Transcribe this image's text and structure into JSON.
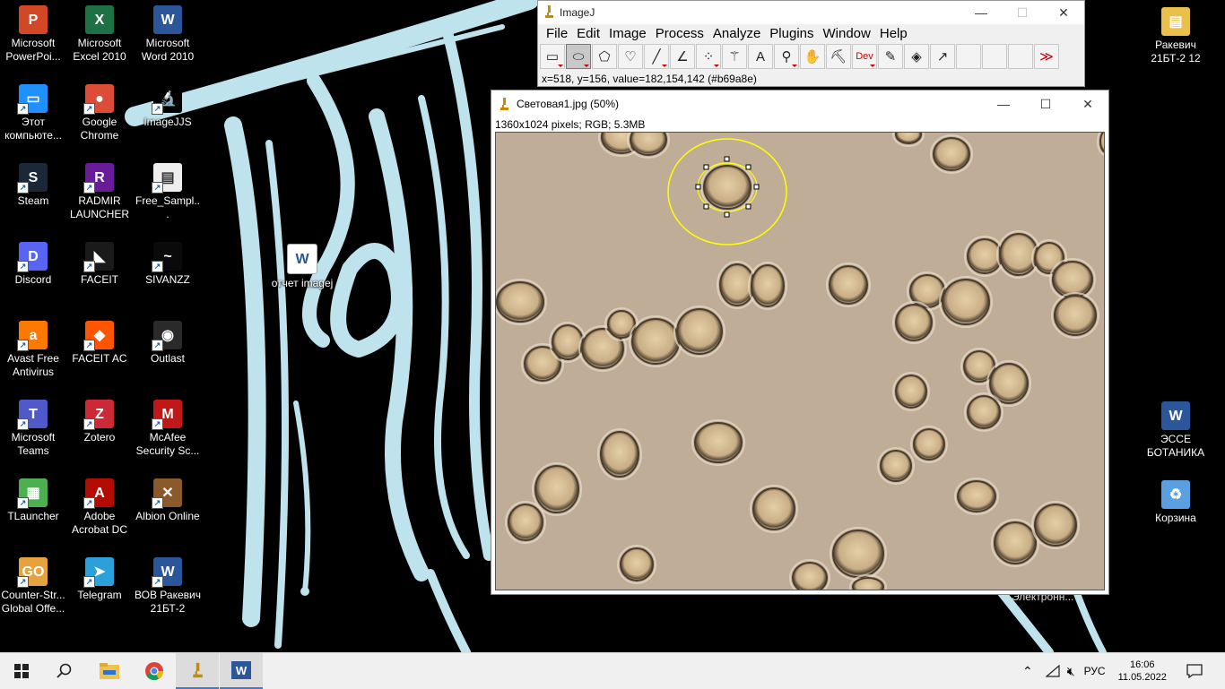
{
  "desktop": {
    "icons": [
      {
        "label": "Microsoft PowerPoi...",
        "icon": "powerpoint-icon",
        "color": "#d24726",
        "glyph": "P"
      },
      {
        "label": "Microsoft Excel 2010",
        "icon": "excel-icon",
        "color": "#1e7145",
        "glyph": "X"
      },
      {
        "label": "Microsoft Word 2010",
        "icon": "word-icon",
        "color": "#2b579a",
        "glyph": "W"
      },
      {
        "label": "Этот компьюте...",
        "icon": "computer-icon",
        "color": "#1e90ff",
        "glyph": "▭"
      },
      {
        "label": "Google Chrome",
        "icon": "chrome-icon",
        "color": "#dd4b39",
        "glyph": "●"
      },
      {
        "label": "ImageJJS",
        "icon": "imagej-icon",
        "color": "#000000",
        "glyph": "🔬"
      },
      {
        "label": "Steam",
        "icon": "steam-icon",
        "color": "#1b2838",
        "glyph": "S"
      },
      {
        "label": "RADMIR LAUNCHER",
        "icon": "radmir-icon",
        "color": "#6a1b9a",
        "glyph": "R"
      },
      {
        "label": "Free_Sampl...",
        "icon": "sivanzz-file-icon",
        "color": "#eeeeee",
        "glyph": "▤"
      },
      {
        "label": "Discord",
        "icon": "discord-icon",
        "color": "#5865f2",
        "glyph": "D"
      },
      {
        "label": "FACEIT",
        "icon": "faceit-icon",
        "color": "#1a1a1a",
        "glyph": "◣"
      },
      {
        "label": "SIVANZZ",
        "icon": "sivanzz-icon",
        "color": "#0a0a0a",
        "glyph": "~"
      },
      {
        "label": "Avast Free Antivirus",
        "icon": "avast-icon",
        "color": "#ff7800",
        "glyph": "a"
      },
      {
        "label": "FACEIT AC",
        "icon": "faceit-ac-icon",
        "color": "#ff5500",
        "glyph": "◆"
      },
      {
        "label": "Outlast",
        "icon": "outlast-icon",
        "color": "#2a2a2a",
        "glyph": "◉"
      },
      {
        "label": "Microsoft Teams",
        "icon": "teams-icon",
        "color": "#5059c9",
        "glyph": "T"
      },
      {
        "label": "Zotero",
        "icon": "zotero-icon",
        "color": "#cc2936",
        "glyph": "Z"
      },
      {
        "label": "McAfee Security Sc...",
        "icon": "mcafee-icon",
        "color": "#c01818",
        "glyph": "M"
      },
      {
        "label": "TLauncher",
        "icon": "tlauncher-icon",
        "color": "#4caf50",
        "glyph": "▦"
      },
      {
        "label": "Adobe Acrobat DC",
        "icon": "acrobat-icon",
        "color": "#b30b00",
        "glyph": "A"
      },
      {
        "label": "Albion Online",
        "icon": "albion-icon",
        "color": "#8b5a2b",
        "glyph": "✕"
      },
      {
        "label": "Counter-Str... Global Offe...",
        "icon": "csgo-icon",
        "color": "#e6a23c",
        "glyph": "GO"
      },
      {
        "label": "Telegram",
        "icon": "telegram-icon",
        "color": "#2aa1da",
        "glyph": "➤"
      },
      {
        "label": "ВОВ Ракевич 21БТ-2",
        "icon": "word-doc-icon",
        "color": "#2b579a",
        "glyph": "W"
      }
    ],
    "middle_doc": {
      "label": "отчет imagej",
      "icon": "word-doc-icon"
    },
    "right_icons": [
      {
        "label": "Ракевич 21БТ-2 12",
        "icon": "zip-folder-icon",
        "color": "#e8c04a",
        "glyph": "▤"
      },
      {
        "label": "ЭССЕ БОТАНИКА",
        "icon": "word-doc-icon",
        "color": "#2b579a",
        "glyph": "W"
      },
      {
        "label": "Корзина",
        "icon": "recycle-bin-icon",
        "color": "#5aa0e0",
        "glyph": "♻"
      }
    ],
    "hidden_label": "Электронн..."
  },
  "imagej": {
    "title": "ImageJ",
    "menu": [
      "File",
      "Edit",
      "Image",
      "Process",
      "Analyze",
      "Plugins",
      "Window",
      "Help"
    ],
    "tools": [
      {
        "name": "rectangle-tool",
        "glyph": "▭",
        "dd": true
      },
      {
        "name": "oval-tool",
        "glyph": "⬭",
        "dd": true,
        "selected": true
      },
      {
        "name": "polygon-tool",
        "glyph": "⬠"
      },
      {
        "name": "freehand-tool",
        "glyph": "♡"
      },
      {
        "name": "line-tool",
        "glyph": "╱",
        "dd": true
      },
      {
        "name": "angle-tool",
        "glyph": "∠"
      },
      {
        "name": "point-tool",
        "glyph": "⁘",
        "dd": true
      },
      {
        "name": "wand-tool",
        "glyph": "⚚"
      },
      {
        "name": "text-tool",
        "glyph": "A"
      },
      {
        "name": "magnifier-tool",
        "glyph": "⚲",
        "dd": true
      },
      {
        "name": "hand-tool",
        "glyph": "✋"
      },
      {
        "name": "dropper-tool",
        "glyph": "⛏"
      },
      {
        "name": "dev-tool",
        "glyph": "Dev",
        "dd": true
      },
      {
        "name": "brush-tool",
        "glyph": "✎"
      },
      {
        "name": "flood-fill-tool",
        "glyph": "◈"
      },
      {
        "name": "arrow-tool",
        "glyph": "↗"
      },
      {
        "name": "empty-tool-1",
        "glyph": ""
      },
      {
        "name": "empty-tool-2",
        "glyph": ""
      },
      {
        "name": "empty-tool-3",
        "glyph": ""
      },
      {
        "name": "more-tools",
        "glyph": "≫"
      }
    ],
    "status": "x=518, y=156, value=182,154,142 (#b69a8e)"
  },
  "image_window": {
    "title": "Световая1.jpg (50%)",
    "info": "1360x1024 pixels; RGB; 5.3MB"
  },
  "taskbar": {
    "language": "РУС",
    "time": "16:06",
    "date": "11.05.2022"
  },
  "colors": {
    "accent": "#3a7bd5",
    "selection": "#ffff00",
    "imagej_red": "#cc0000",
    "wallpaper_stroke": "#bfe3ec"
  }
}
